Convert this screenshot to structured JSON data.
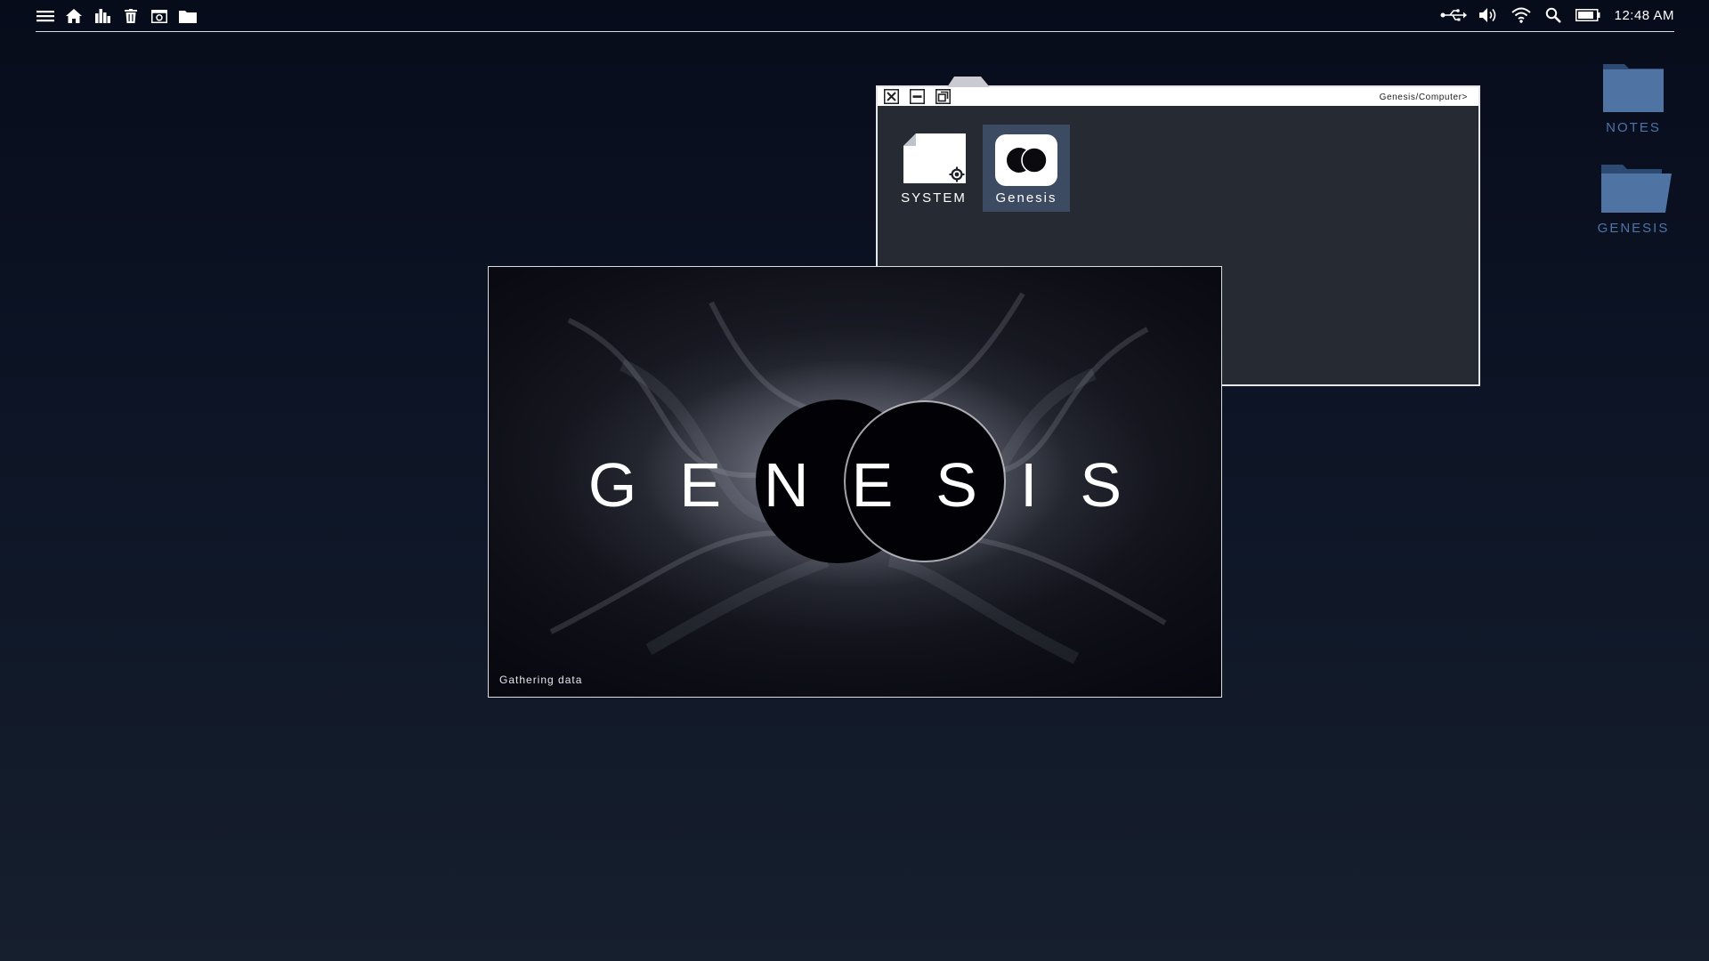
{
  "topbar": {
    "left_icons": [
      "menu-icon",
      "home-icon",
      "stats-icon",
      "trash-icon",
      "screenshot-icon",
      "folder-icon"
    ],
    "right_icons": [
      "usb-icon",
      "volume-icon",
      "wifi-icon",
      "search-icon",
      "battery-icon"
    ],
    "clock": "12:48 AM"
  },
  "desktop": {
    "folders": [
      {
        "label": "NOTES"
      },
      {
        "label": "GENESIS"
      }
    ]
  },
  "explorer": {
    "path": "Genesis/Computer>",
    "items": [
      {
        "label": "SYSTEM",
        "icon": "system-file-icon",
        "selected": false
      },
      {
        "label": "Genesis",
        "icon": "genesis-app-icon",
        "selected": true
      }
    ]
  },
  "splash": {
    "title": "GENESIS",
    "status": "Gathering data"
  },
  "colors": {
    "folder_blue": "#4e74a6",
    "selection": "#3c4b62",
    "window_body": "#262a33"
  }
}
